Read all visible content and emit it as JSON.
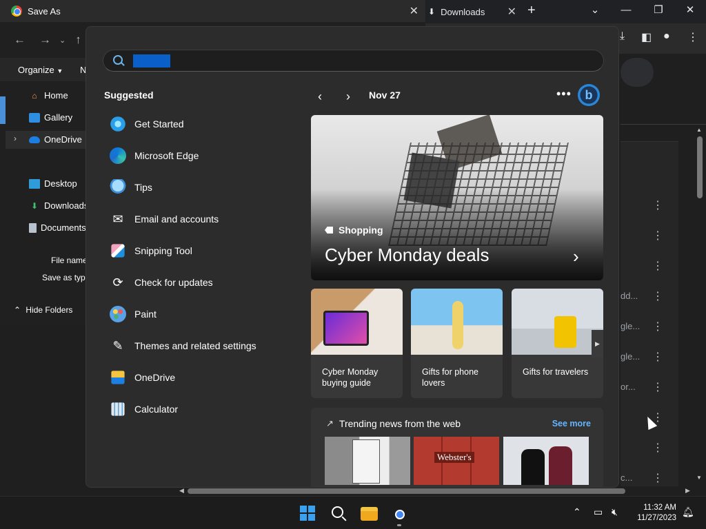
{
  "chrome": {
    "tab_title": "Downloads",
    "download_rows": [
      "dd...",
      "gle...",
      "gle...",
      "or...",
      "c..."
    ]
  },
  "save_dialog": {
    "title": "Save As",
    "organize_label": "Organize",
    "new_folder_label": "N",
    "nav_items": [
      "Home",
      "Gallery",
      "OneDrive",
      "Desktop",
      "Downloads",
      "Documents"
    ],
    "file_name_label": "File name",
    "save_as_type_label": "Save as type",
    "hide_folders_label": "Hide Folders"
  },
  "start_menu": {
    "suggested_title": "Suggested",
    "apps": [
      "Get Started",
      "Microsoft Edge",
      "Tips",
      "Email and accounts",
      "Snipping Tool",
      "Check for updates",
      "Paint",
      "Themes and related settings",
      "OneDrive",
      "Calculator"
    ],
    "feed": {
      "date": "Nov 27",
      "hero_category": "Shopping",
      "hero_title": "Cyber Monday deals",
      "cards": [
        "Cyber Monday buying guide",
        "Gifts for phone lovers",
        "Gifts for travelers"
      ],
      "trending_title": "Trending news from the web",
      "see_more": "See more"
    }
  },
  "taskbar": {
    "time": "11:32 AM",
    "date": "11/27/2023"
  },
  "colors": {
    "accent": "#3aa0f0",
    "link": "#66b4ff",
    "selection": "#0a5fc8"
  }
}
